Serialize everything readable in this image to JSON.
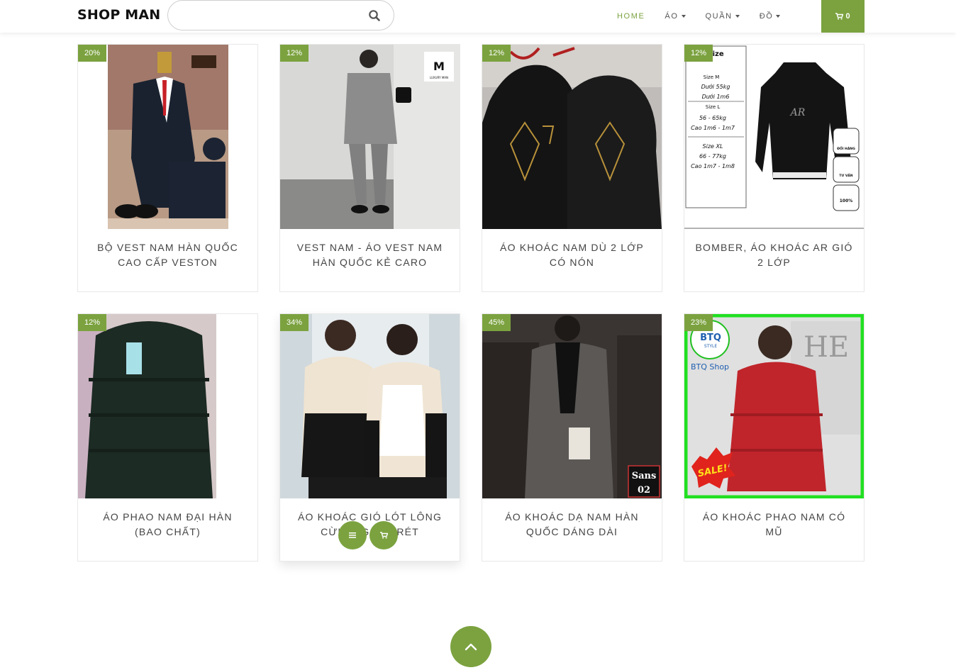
{
  "header": {
    "logo": "SHOP MAN",
    "search": {
      "value": "",
      "placeholder": "",
      "icon": "search-icon"
    },
    "nav": [
      {
        "label": "HOME",
        "active": true,
        "dropdown": false
      },
      {
        "label": "ÁO",
        "active": false,
        "dropdown": true
      },
      {
        "label": "QUẦN",
        "active": false,
        "dropdown": true
      },
      {
        "label": "ĐỒ",
        "active": false,
        "dropdown": true
      }
    ],
    "cart": {
      "icon": "cart-icon",
      "count": "0"
    }
  },
  "products": [
    {
      "title": "BỘ VEST NAM HÀN QUỐC CAO CẤP VESTON",
      "discount": "20%"
    },
    {
      "title": "VEST NAM - ÁO VEST NAM HÀN QUỐC KẺ CARO",
      "discount": "12%",
      "image_text": "LUXURY MAN"
    },
    {
      "title": "ÁO KHOÁC NAM DÙ 2 LỚP CÓ NÓN",
      "discount": "12%"
    },
    {
      "title": "BOMBER, ÁO KHOÁC AR GIÓ 2 LỚP",
      "discount": "12%",
      "size_chart": [
        "Size M",
        "Dưới 55kg",
        "Dưới 1m6",
        "Size L",
        "56 - 65kg",
        "Cao 1m6 - 1m7",
        "Size XL",
        "66 - 77kg",
        "Cao 1m7 - 1m8"
      ],
      "image_badges": [
        "ĐỔI HÀNG",
        "TƯ VẤN",
        "100%"
      ]
    },
    {
      "title": "ÁO PHAO NAM ĐẠI HÀN (BAO CHẤT)",
      "discount": "12%"
    },
    {
      "title": "ÁO KHOÁC GIÓ LÓT LÔNG CỪU C   G   GIÁ RÉT",
      "discount": "34%"
    },
    {
      "title": "ÁO KHOÁC DẠ NAM HÀN QUỐC DÁNG DÀI",
      "discount": "45%",
      "image_text": [
        "Sans",
        "02"
      ]
    },
    {
      "title": "ÁO KHOÁC PHAO NAM CÓ MŨ",
      "discount": "23%",
      "image_text": [
        "BTQ",
        "STYLE",
        "BTQ Shop",
        "SALE!"
      ]
    }
  ],
  "hover_actions": {
    "detail_icon": "menu-icon",
    "cart_icon": "cart-icon"
  },
  "back_to_top": {
    "icon": "chevron-up-icon"
  },
  "colors": {
    "accent": "#7ba23f",
    "text": "#444444",
    "border": "#e8e8e8"
  }
}
